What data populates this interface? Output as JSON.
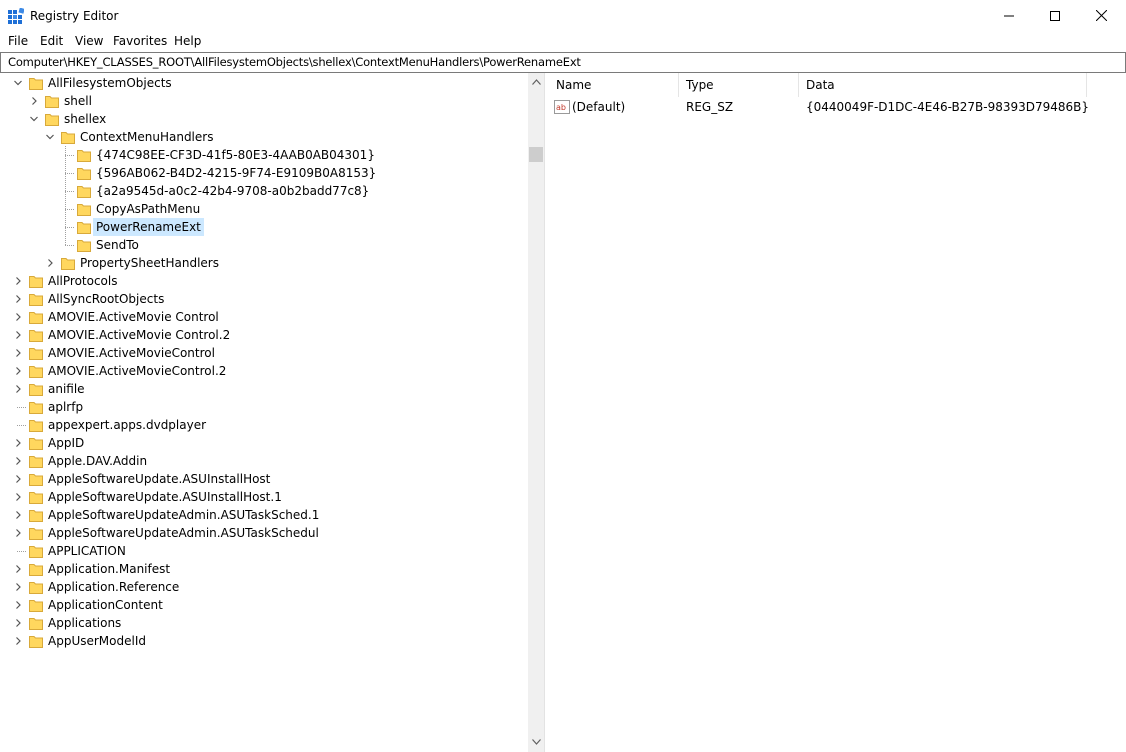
{
  "window": {
    "title": "Registry Editor",
    "minimize_glyph": "—",
    "maximize_glyph": "☐",
    "close_glyph": "✕"
  },
  "menu": {
    "items": [
      "File",
      "Edit",
      "View",
      "Favorites",
      "Help"
    ]
  },
  "address": {
    "path": "Computer\\HKEY_CLASSES_ROOT\\AllFilesystemObjects\\shellex\\ContextMenuHandlers\\PowerRenameExt"
  },
  "tree": {
    "items": [
      {
        "label": "AllFilesystemObjects",
        "expander": "expanded"
      },
      {
        "label": "shell",
        "expander": "collapsed"
      },
      {
        "label": "shellex",
        "expander": "expanded"
      },
      {
        "label": "ContextMenuHandlers",
        "expander": "expanded"
      },
      {
        "label": "{474C98EE-CF3D-41f5-80E3-4AAB0AB04301}",
        "expander": "none"
      },
      {
        "label": "{596AB062-B4D2-4215-9F74-E9109B0A8153}",
        "expander": "none"
      },
      {
        "label": "{a2a9545d-a0c2-42b4-9708-a0b2badd77c8}",
        "expander": "none"
      },
      {
        "label": "CopyAsPathMenu",
        "expander": "none"
      },
      {
        "label": "PowerRenameExt",
        "expander": "none",
        "selected": true
      },
      {
        "label": "SendTo",
        "expander": "none"
      },
      {
        "label": "PropertySheetHandlers",
        "expander": "collapsed"
      },
      {
        "label": "AllProtocols",
        "expander": "collapsed"
      },
      {
        "label": "AllSyncRootObjects",
        "expander": "collapsed"
      },
      {
        "label": "AMOVIE.ActiveMovie Control",
        "expander": "collapsed"
      },
      {
        "label": "AMOVIE.ActiveMovie Control.2",
        "expander": "collapsed"
      },
      {
        "label": "AMOVIE.ActiveMovieControl",
        "expander": "collapsed"
      },
      {
        "label": "AMOVIE.ActiveMovieControl.2",
        "expander": "collapsed"
      },
      {
        "label": "anifile",
        "expander": "collapsed"
      },
      {
        "label": "aplrfp",
        "expander": "none"
      },
      {
        "label": "appexpert.apps.dvdplayer",
        "expander": "none"
      },
      {
        "label": "AppID",
        "expander": "collapsed"
      },
      {
        "label": "Apple.DAV.Addin",
        "expander": "collapsed"
      },
      {
        "label": "AppleSoftwareUpdate.ASUInstallHost",
        "expander": "collapsed"
      },
      {
        "label": "AppleSoftwareUpdate.ASUInstallHost.1",
        "expander": "collapsed"
      },
      {
        "label": "AppleSoftwareUpdateAdmin.ASUTaskSched.1",
        "expander": "collapsed"
      },
      {
        "label": "AppleSoftwareUpdateAdmin.ASUTaskSchedul",
        "expander": "collapsed"
      },
      {
        "label": "APPLICATION",
        "expander": "none"
      },
      {
        "label": "Application.Manifest",
        "expander": "collapsed"
      },
      {
        "label": "Application.Reference",
        "expander": "collapsed"
      },
      {
        "label": "ApplicationContent",
        "expander": "collapsed"
      },
      {
        "label": "Applications",
        "expander": "collapsed"
      },
      {
        "label": "AppUserModelId",
        "expander": "collapsed"
      }
    ]
  },
  "list": {
    "columns": [
      "Name",
      "Type",
      "Data"
    ],
    "rows": [
      {
        "name": "(Default)",
        "type": "REG_SZ",
        "data": "{0440049F-D1DC-4E46-B27B-98393D79486B}"
      }
    ]
  },
  "colors": {
    "folder": "#ffd75e",
    "selection": "#cce8ff",
    "accent": "#0078d7"
  }
}
